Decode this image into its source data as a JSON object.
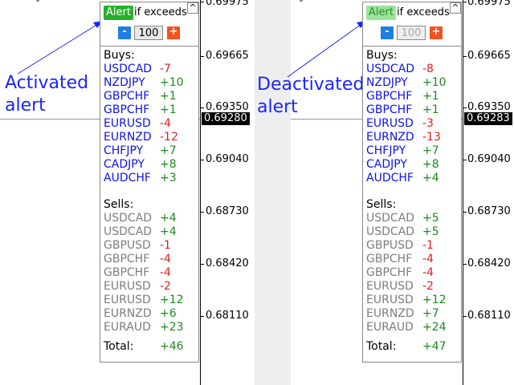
{
  "panels": [
    {
      "annotation": "Activated\nalert",
      "alert_label": "Alert",
      "alert_state": "active",
      "exceeds_label": "if exceeds",
      "collapse_label": "^",
      "minus_label": "-",
      "plus_label": "+",
      "threshold_value": "100",
      "buys_title": "Buys:",
      "buys": [
        {
          "pair": "USDCAD",
          "value": "-7",
          "sign": "neg"
        },
        {
          "pair": "NZDJPY",
          "value": "+10",
          "sign": "pos"
        },
        {
          "pair": "GBPCHF",
          "value": "+1",
          "sign": "pos"
        },
        {
          "pair": "GBPCHF",
          "value": "+1",
          "sign": "pos"
        },
        {
          "pair": "EURUSD",
          "value": "-4",
          "sign": "neg"
        },
        {
          "pair": "EURNZD",
          "value": "-12",
          "sign": "neg"
        },
        {
          "pair": "CHFJPY",
          "value": "+7",
          "sign": "pos"
        },
        {
          "pair": "CADJPY",
          "value": "+8",
          "sign": "pos"
        },
        {
          "pair": "AUDCHF",
          "value": "+3",
          "sign": "pos"
        }
      ],
      "sells_title": "Sells:",
      "sells": [
        {
          "pair": "USDCAD",
          "value": "+4",
          "sign": "pos"
        },
        {
          "pair": "USDCAD",
          "value": "+4",
          "sign": "pos"
        },
        {
          "pair": "GBPUSD",
          "value": "-1",
          "sign": "neg"
        },
        {
          "pair": "GBPCHF",
          "value": "-4",
          "sign": "neg"
        },
        {
          "pair": "GBPCHF",
          "value": "-4",
          "sign": "neg"
        },
        {
          "pair": "EURUSD",
          "value": "-2",
          "sign": "neg"
        },
        {
          "pair": "EURUSD",
          "value": "+12",
          "sign": "pos"
        },
        {
          "pair": "EURNZD",
          "value": "+6",
          "sign": "pos"
        },
        {
          "pair": "EURAUD",
          "value": "+23",
          "sign": "pos"
        }
      ],
      "total_label": "Total:",
      "total_value": "+46",
      "axis_ticks": [
        "0.69975",
        "0.69665",
        "0.69350",
        "0.69040",
        "0.68730",
        "0.68420",
        "0.68110"
      ],
      "current_price": "0.69280"
    },
    {
      "annotation": "Deactivated\nalert",
      "alert_label": "Alert",
      "alert_state": "inactive",
      "exceeds_label": "if exceeds",
      "collapse_label": "^",
      "minus_label": "-",
      "plus_label": "+",
      "threshold_value": "100",
      "buys_title": "Buys:",
      "buys": [
        {
          "pair": "USDCAD",
          "value": "-8",
          "sign": "neg"
        },
        {
          "pair": "NZDJPY",
          "value": "+10",
          "sign": "pos"
        },
        {
          "pair": "GBPCHF",
          "value": "+1",
          "sign": "pos"
        },
        {
          "pair": "GBPCHF",
          "value": "+1",
          "sign": "pos"
        },
        {
          "pair": "EURUSD",
          "value": "-3",
          "sign": "neg"
        },
        {
          "pair": "EURNZD",
          "value": "-13",
          "sign": "neg"
        },
        {
          "pair": "CHFJPY",
          "value": "+7",
          "sign": "pos"
        },
        {
          "pair": "CADJPY",
          "value": "+8",
          "sign": "pos"
        },
        {
          "pair": "AUDCHF",
          "value": "+4",
          "sign": "pos"
        }
      ],
      "sells_title": "Sells:",
      "sells": [
        {
          "pair": "USDCAD",
          "value": "+5",
          "sign": "pos"
        },
        {
          "pair": "USDCAD",
          "value": "+5",
          "sign": "pos"
        },
        {
          "pair": "GBPUSD",
          "value": "-1",
          "sign": "neg"
        },
        {
          "pair": "GBPCHF",
          "value": "-4",
          "sign": "neg"
        },
        {
          "pair": "GBPCHF",
          "value": "-4",
          "sign": "neg"
        },
        {
          "pair": "EURUSD",
          "value": "-2",
          "sign": "neg"
        },
        {
          "pair": "EURUSD",
          "value": "+12",
          "sign": "pos"
        },
        {
          "pair": "EURNZD",
          "value": "+7",
          "sign": "pos"
        },
        {
          "pair": "EURAUD",
          "value": "+24",
          "sign": "pos"
        }
      ],
      "total_label": "Total:",
      "total_value": "+47",
      "axis_ticks": [
        "0.69975",
        "0.69665",
        "0.69350",
        "0.69040",
        "0.68730",
        "0.68420",
        "0.68110"
      ],
      "current_price": "0.69283"
    }
  ],
  "colors": {
    "buy_pair": "#0d13e8",
    "sell_pair": "#7d7d7d",
    "positive": "#1a8a1a",
    "negative": "#e01f1f",
    "alert_active": "#27b12a",
    "alert_inactive": "#9be59b",
    "minus_button": "#1e7fe3",
    "plus_button": "#f4511e",
    "annotation": "#1a24ff"
  }
}
